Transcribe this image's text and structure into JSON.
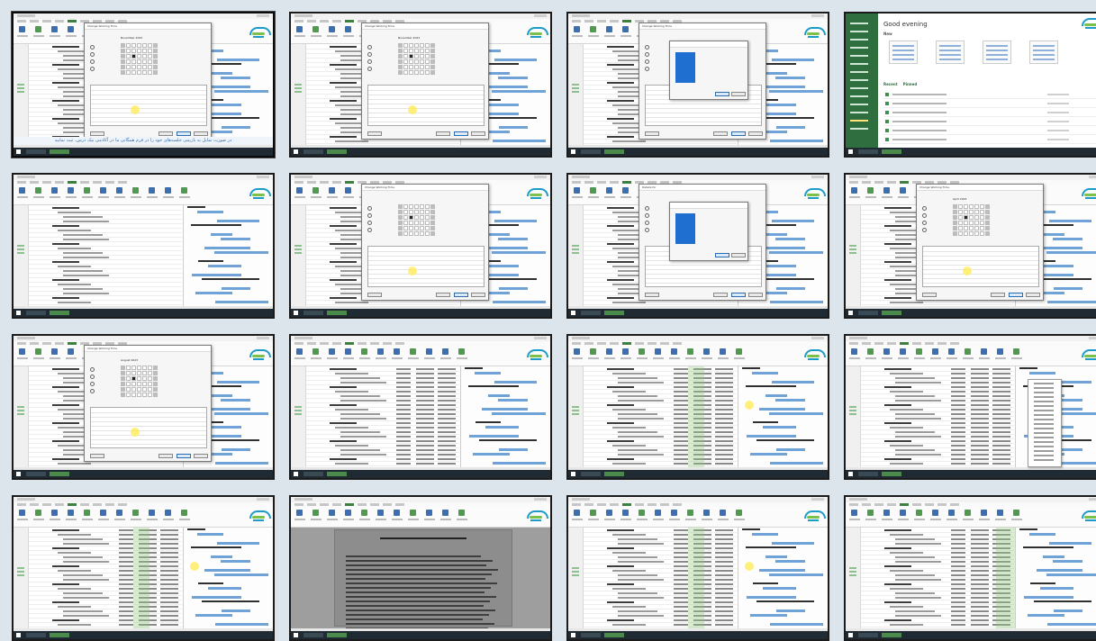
{
  "thumbnails": [
    {
      "id": "t1",
      "kind": "project-dialog",
      "caption": "در صورت تمایل به بازبینی جلسه‌های خود را در فرم همگانی ما در آکادمی نیک درس، ثبت نمایید",
      "dialog_title": "Change Working Time",
      "dialog_month": "November 2023",
      "selected": true
    },
    {
      "id": "t2",
      "kind": "project-dialog",
      "dialog_title": "Change Working Time",
      "dialog_month": "November 2023"
    },
    {
      "id": "t3",
      "kind": "project-dialog-sub",
      "dialog_title": "Change Working Time"
    },
    {
      "id": "t4",
      "kind": "backstage",
      "greeting": "Good evening",
      "new_label": "New",
      "tabs": [
        "Recent",
        "Pinned"
      ]
    },
    {
      "id": "t5",
      "kind": "project-ribbon"
    },
    {
      "id": "t6",
      "kind": "project-dialog",
      "dialog_title": "Change Working Time"
    },
    {
      "id": "t7",
      "kind": "project-dialog-sub",
      "dialog_title": "Details for"
    },
    {
      "id": "t8",
      "kind": "project-dialog",
      "dialog_title": "Change Working Time",
      "dialog_month": "April 2024"
    },
    {
      "id": "t9",
      "kind": "project-dialog",
      "dialog_title": "Change Working Time",
      "dialog_month": "August 2023"
    },
    {
      "id": "t10",
      "kind": "project-table"
    },
    {
      "id": "t11",
      "kind": "project-table-hl"
    },
    {
      "id": "t12",
      "kind": "project-ctx"
    },
    {
      "id": "t13",
      "kind": "project-table-hl"
    },
    {
      "id": "t14",
      "kind": "word-doc"
    },
    {
      "id": "t15",
      "kind": "project-table-hl"
    },
    {
      "id": "t16",
      "kind": "project-table-hl2"
    }
  ],
  "colors": {
    "project_green": "#2f6f3f",
    "gantt_bar": "#6fa3d8",
    "frame_border": "#1b1b1b",
    "page_bg": "#dde5ec"
  }
}
